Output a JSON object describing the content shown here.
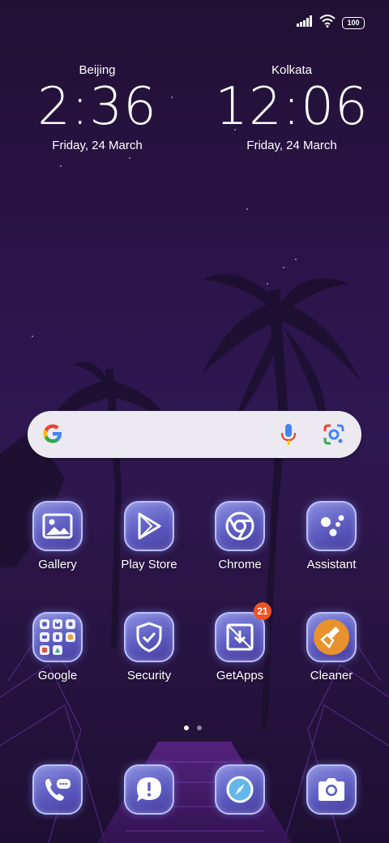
{
  "status_bar": {
    "battery": "100",
    "signal_icon": "signal-icon",
    "wifi_icon": "wifi-icon"
  },
  "clocks": [
    {
      "city": "Beijing",
      "time": "2:36",
      "date": "Friday, 24 March"
    },
    {
      "city": "Kolkata",
      "time": "12:06",
      "date": "Friday, 24 March"
    }
  ],
  "search_bar": {
    "logo_icon": "google-g-icon",
    "mic_icon": "mic-icon",
    "lens_icon": "google-lens-icon"
  },
  "apps_row1": [
    {
      "label": "Gallery",
      "icon": "gallery-icon"
    },
    {
      "label": "Play Store",
      "icon": "play-store-icon"
    },
    {
      "label": "Chrome",
      "icon": "chrome-icon"
    },
    {
      "label": "Assistant",
      "icon": "assistant-icon"
    }
  ],
  "apps_row2": [
    {
      "label": "Google",
      "icon": "google-folder-icon"
    },
    {
      "label": "Security",
      "icon": "security-shield-icon"
    },
    {
      "label": "GetApps",
      "icon": "getapps-icon",
      "badge": "21"
    },
    {
      "label": "Cleaner",
      "icon": "cleaner-brush-icon"
    }
  ],
  "dock": [
    {
      "icon": "phone-icon"
    },
    {
      "icon": "messages-icon"
    },
    {
      "icon": "compass-icon"
    },
    {
      "icon": "camera-icon"
    }
  ],
  "page_indicator": {
    "pages": 2,
    "current": 1
  }
}
